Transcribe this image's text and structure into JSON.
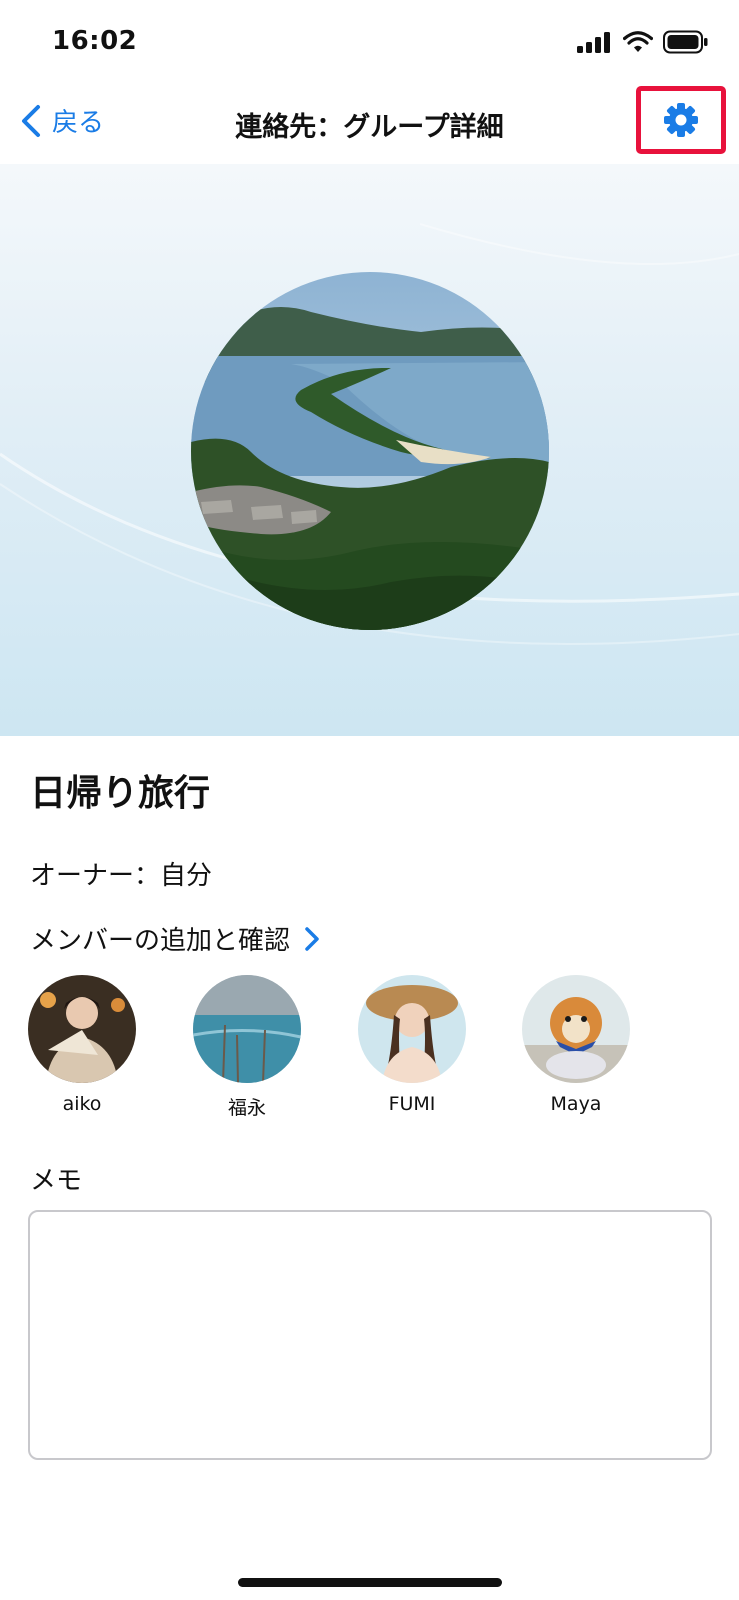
{
  "status_bar": {
    "time": "16:02"
  },
  "nav": {
    "back_label": "戻る",
    "title": "連絡先：グループ詳細",
    "settings_icon": "gear-icon"
  },
  "group": {
    "name": "日帰り旅行",
    "owner_line": "オーナー：自分",
    "members_link_label": "メンバーの追加と確認",
    "members": [
      {
        "name": "aiko"
      },
      {
        "name": "福永"
      },
      {
        "name": "FUMI"
      },
      {
        "name": "Maya"
      }
    ]
  },
  "memo": {
    "label": "メモ",
    "value": ""
  },
  "colors": {
    "accent": "#1a7ce6",
    "highlight_border": "#e8123c"
  }
}
